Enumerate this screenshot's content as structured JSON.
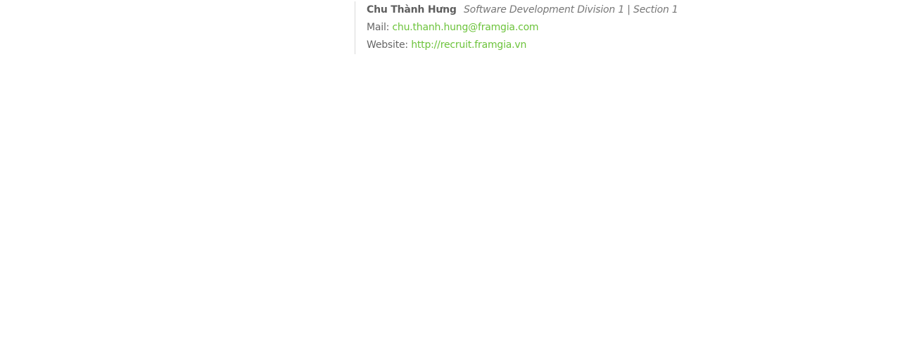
{
  "signature": {
    "name": "Chu Thành Hưng",
    "division": "Software Development Division 1 | Section 1",
    "mail_label": "Mail:",
    "mail_value": "chu.thanh.hung@framgia.com",
    "website_label": "Website:",
    "website_value": "http://recruit.framgia.vn"
  },
  "colors": {
    "link": "#6cc33b",
    "text": "#666666",
    "divider": "#d9d9d9"
  }
}
